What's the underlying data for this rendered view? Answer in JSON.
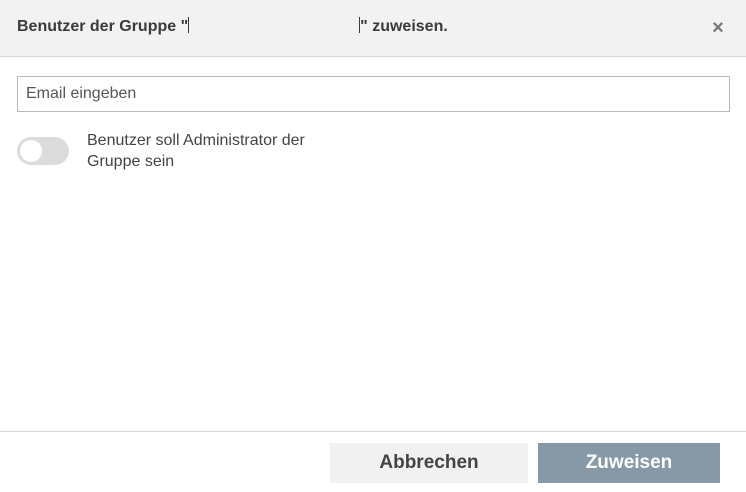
{
  "dialog": {
    "title_prefix": "Benutzer der Gruppe \"",
    "title_suffix": "\" zuweisen.",
    "close_icon": "×"
  },
  "form": {
    "email_placeholder": "Email eingeben",
    "email_value": "",
    "admin_toggle_label": "Benutzer soll Administrator der Gruppe sein",
    "admin_toggle_on": false
  },
  "footer": {
    "cancel_label": "Abbrechen",
    "assign_label": "Zuweisen"
  },
  "colors": {
    "header_bg": "#f2f2f2",
    "assign_button_bg": "#8799a6",
    "cancel_button_bg": "#f1f1f1",
    "toggle_off_bg": "#dcdcdc"
  }
}
